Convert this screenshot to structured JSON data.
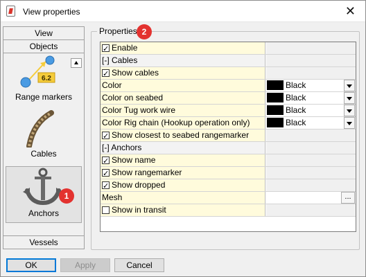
{
  "window": {
    "title": "View properties",
    "close_glyph": "✕",
    "app_icon": "document-edit-icon"
  },
  "nav": {
    "tabs": {
      "view": "View",
      "objects": "Objects",
      "vessels": "Vessels"
    },
    "items": [
      {
        "label": "Range markers",
        "icon": "range-marker-icon",
        "marker_value": "6.2"
      },
      {
        "label": "Cables",
        "icon": "rope-icon"
      },
      {
        "label": "Anchors",
        "icon": "anchor-icon",
        "selected": true
      }
    ]
  },
  "badges": {
    "one": "1",
    "two": "2"
  },
  "properties": {
    "group_label": "Properties",
    "rows": [
      {
        "label": "Enable",
        "checkbox": true,
        "checked": true
      },
      {
        "label": "[-] Cables",
        "section": true
      },
      {
        "label": "Show cables",
        "checkbox": true,
        "checked": true
      },
      {
        "label": "Color",
        "color_value": "Black",
        "color_hex": "#000000"
      },
      {
        "label": "Color on seabed",
        "color_value": "Black",
        "color_hex": "#000000"
      },
      {
        "label": "Color Tug work wire",
        "color_value": "Black",
        "color_hex": "#000000"
      },
      {
        "label": "Color Rig chain (Hookup operation only)",
        "color_value": "Black",
        "color_hex": "#000000"
      },
      {
        "label": "Show closest to seabed rangemarker",
        "checkbox": true,
        "checked": true
      },
      {
        "label": "[-] Anchors",
        "section": true
      },
      {
        "label": "Show name",
        "checkbox": true,
        "checked": true
      },
      {
        "label": "Show rangemarker",
        "checkbox": true,
        "checked": true
      },
      {
        "label": "Show dropped",
        "checkbox": true,
        "checked": true
      },
      {
        "label": "Mesh",
        "button_text": "..."
      },
      {
        "label": "Show in transit",
        "checkbox": true,
        "checked": false
      }
    ]
  },
  "buttons": {
    "ok": "OK",
    "apply": "Apply",
    "cancel": "Cancel"
  },
  "colors": {
    "label_cell_bg": "#fffbdc",
    "badge": "#e3322f",
    "marker_blue": "#4a9be3",
    "marker_label_bg": "#f5cc3a"
  }
}
